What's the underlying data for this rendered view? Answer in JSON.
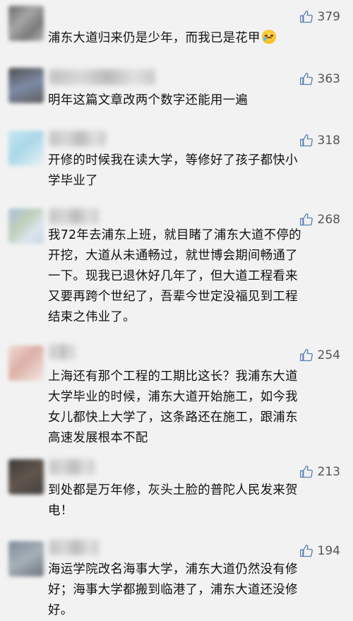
{
  "comments": [
    {
      "likes": "379",
      "text": "浦东大道归来仍是少年，而我已是花甲",
      "emoji": "crying-face"
    },
    {
      "likes": "363",
      "text": "明年这篇文章改两个数字还能用一遍"
    },
    {
      "likes": "318",
      "text": "开修的时候我在读大学，等修好了孩子都快小\n学毕业了"
    },
    {
      "likes": "268",
      "text": "我72年去浦东上班，就目睹了浦东大道不停的\n开挖，大道从未通畅过，就世博会期间畅通了\n一下。现我已退休好几年了，但大道工程看来\n又要再跨个世纪了，吾辈今世定没福见到工程\n结束之伟业了。"
    },
    {
      "likes": "254",
      "text": "上海还有那个工程的工期比这长？我浦东大道\n大学毕业的时候，浦东大道开始施工，如今我\n女儿都快上大学了，这条路还在施工，跟浦东\n高速发展根本不配"
    },
    {
      "likes": "213",
      "text": "到处都是万年修，灰头土脸的普陀人民发来贺\n电！"
    },
    {
      "likes": "194",
      "text": "海运学院改名海事大学，浦东大道仍然没有修\n好；海事大学都搬到临港了，浦东大道还没修\n好。"
    }
  ],
  "icons": {
    "like": "thumbs-up-icon",
    "emoji": "crying-face-emoji"
  },
  "colors": {
    "background": "#f2f2f2",
    "text": "#111111",
    "like_count": "#555555"
  }
}
